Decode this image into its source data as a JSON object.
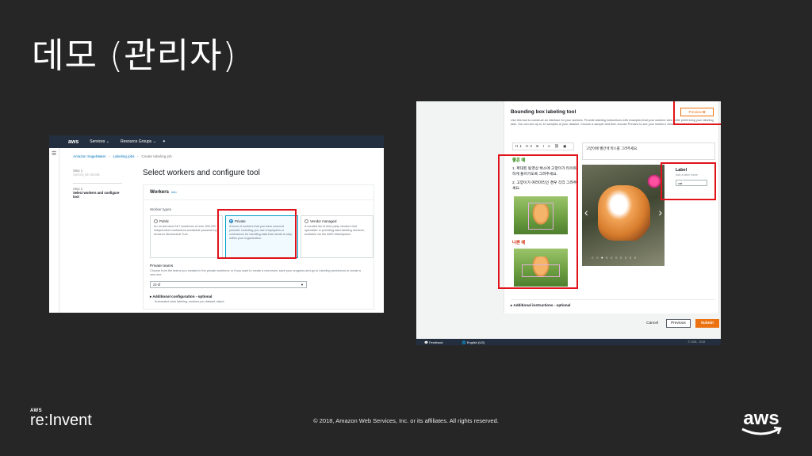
{
  "slide": {
    "title": "데모 (관리자)",
    "copyright": "© 2018, Amazon Web Services, Inc. or its affiliates. All rights reserved.",
    "brand_small": "AWS",
    "brand_big": "re:Invent"
  },
  "console": {
    "logo": "aws",
    "nav": [
      "Services ⌄",
      "Resource Groups ⌄",
      "✦"
    ],
    "breadcrumb": [
      "Amazon SageMaker",
      "Labeling jobs",
      "Create labeling job"
    ],
    "steps": [
      {
        "num": "Step 1",
        "text": "Specify job details"
      },
      {
        "num": "Step 2",
        "text": "Select workers and configure tool"
      }
    ],
    "page_title": "Select workers and configure tool",
    "panel_title": "Workers",
    "panel_info": "Info",
    "worker_types_label": "Worker types",
    "options": [
      {
        "title": "Public",
        "desc": "An on-demand 24/7 workforce of over 500,000 independent contractors worldwide powered by Amazon Mechanical Turk.",
        "selected": false
      },
      {
        "title": "Private",
        "desc": "A team of workers that you have sourced yourself, including you own employees or contractors for handling data that needs to stay within your organization.",
        "selected": true
      },
      {
        "title": "Vendor managed",
        "desc": "A curated list of third party vendors that specialize in providing data labeling services, available via the AWS Marketplace",
        "selected": false
      }
    ],
    "private_teams_label": "Private teams",
    "private_teams_desc": "Choose from the teams you created in the private workforce or if you want to create a new team, save your progress and go to Labeling workforces to create a new one.",
    "private_teams_value": "zz-cf",
    "additional_config": "Additional configuration - optional",
    "additional_config_sub": "Automated data labeling, workers per dataset object"
  },
  "tool": {
    "title": "Bounding box labeling tool",
    "intro": "Use this tool to construct an interface for your workers. Provide labeling instructions with examples that your workers view while performing your labeling task. You can see up to 10 samples of your dataset. Choose a sample and then choose Preview to see your worker's view of the interface.",
    "preview_label": "Preview",
    "editor_toolbar": "H1 H2 B I A ⛓ ▣",
    "instruction_text": "고양이에 빨간색 박스를 그려주세요.",
    "good_title": "좋은 예",
    "good_instr_1": "1. 확대된 동영상 박스에 고양이가 타이트하게 들어가도록 그려주세요.",
    "good_instr_2": "2. 고양이가 여러마리인 경우 각각 그려주세요.",
    "bad_title": "나쁜 예",
    "label_title": "Label",
    "label_sub": "Add a label name",
    "label_value": "cat",
    "additional_instructions": "Additional instructions - optional",
    "btn_cancel": "Cancel",
    "btn_previous": "Previous",
    "btn_submit": "Submit",
    "feedback": "Feedback",
    "language": "English (US)",
    "footer_copy": "© 2008 - 2018"
  },
  "colors": {
    "highlight": "#e0121a",
    "aws_orange": "#ec7211",
    "console_nav": "#232f3e"
  }
}
